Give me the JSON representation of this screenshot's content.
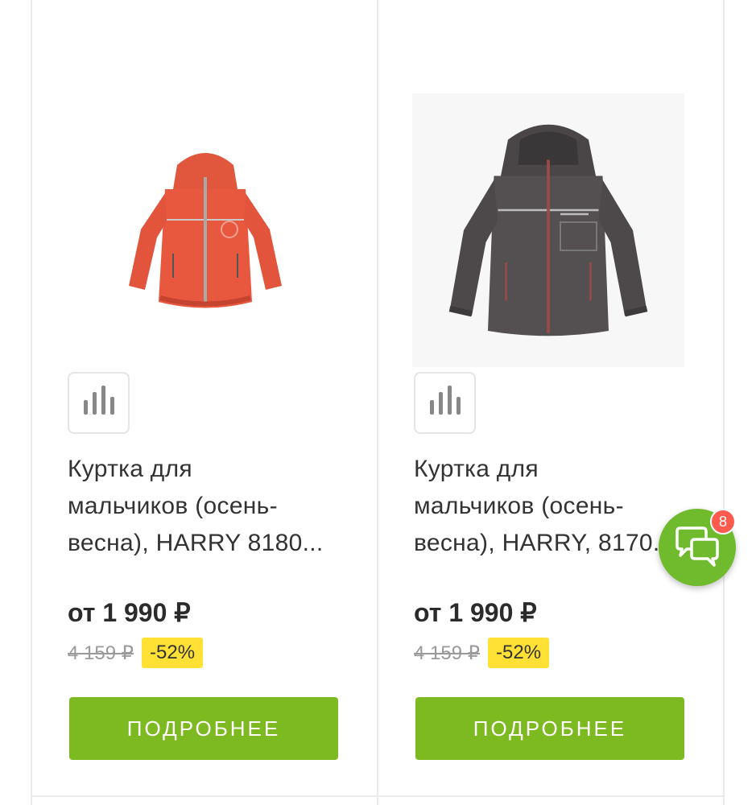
{
  "products": [
    {
      "title_line1": "Куртка для",
      "title_line2": "мальчиков (осень-",
      "title_line3": "весна), HARRY 8180...",
      "price": "от 1 990 ₽",
      "old_price": "4 159 ₽",
      "discount": "-52%",
      "button_label": "ПОДРОБНЕЕ",
      "image_icon": "orange-jacket-image",
      "compare_icon": "compare-chart-icon"
    },
    {
      "title_line1": "Куртка для",
      "title_line2": "мальчиков (осень-",
      "title_line3": "весна), HARRY, 8170...",
      "price": "от 1 990 ₽",
      "old_price": "4 159 ₽",
      "discount": "-52%",
      "button_label": "ПОДРОБНЕЕ",
      "image_icon": "grey-jacket-image",
      "compare_icon": "compare-chart-icon"
    }
  ],
  "chat": {
    "badge_count": "8",
    "icon": "chat-bubbles-icon"
  },
  "colors": {
    "accent_green": "#7db921",
    "discount_yellow": "#ffe135",
    "badge_red": "#ff5a4e",
    "chat_green": "#6fbb2d"
  }
}
